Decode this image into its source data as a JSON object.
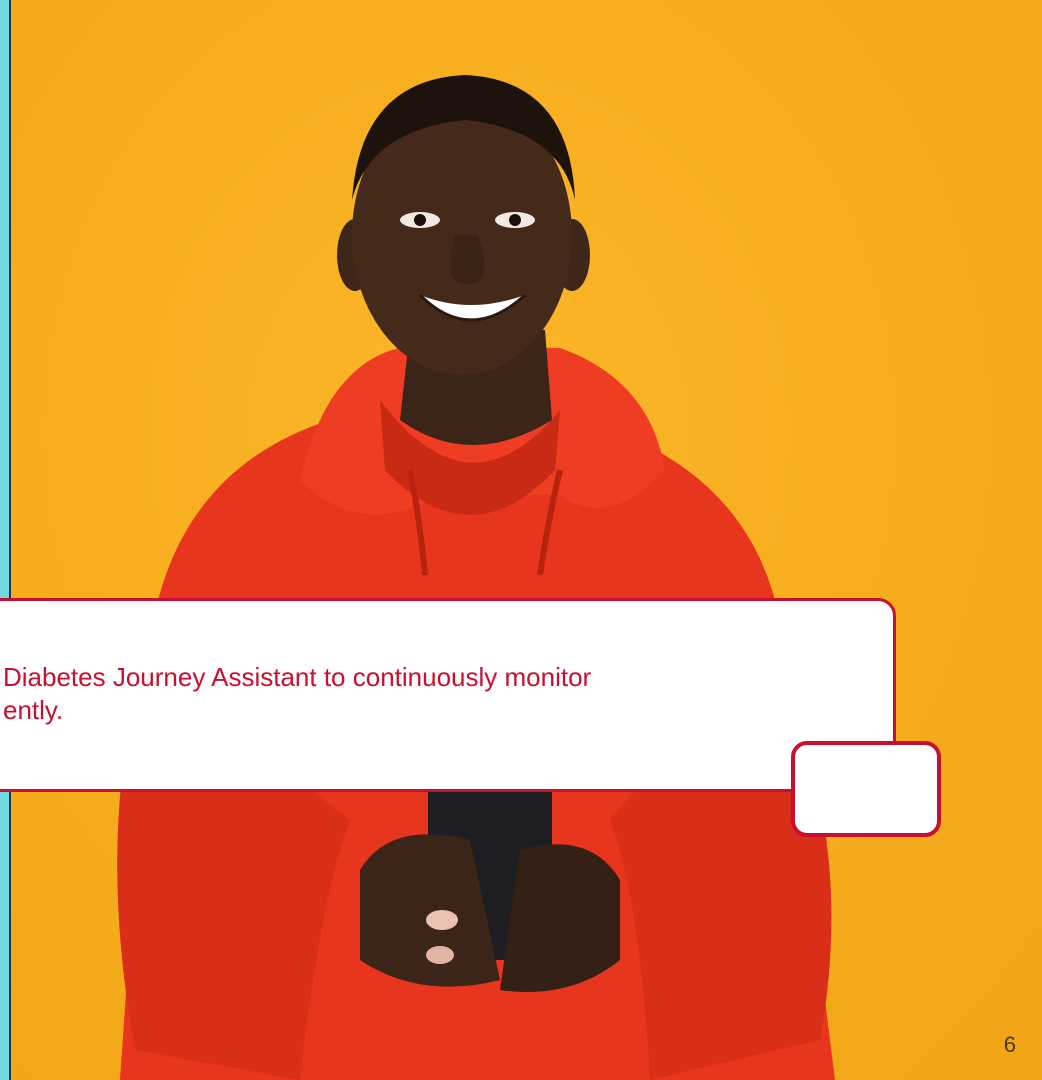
{
  "slide": {
    "callout_text": "Diabetes Journey Assistant to continuously monitor\nently.",
    "page_number": "6"
  },
  "colors": {
    "background": "#f7b021",
    "hoodie": "#e8351e",
    "accent": "#c8102e",
    "left_edge": "#6fd8df"
  }
}
